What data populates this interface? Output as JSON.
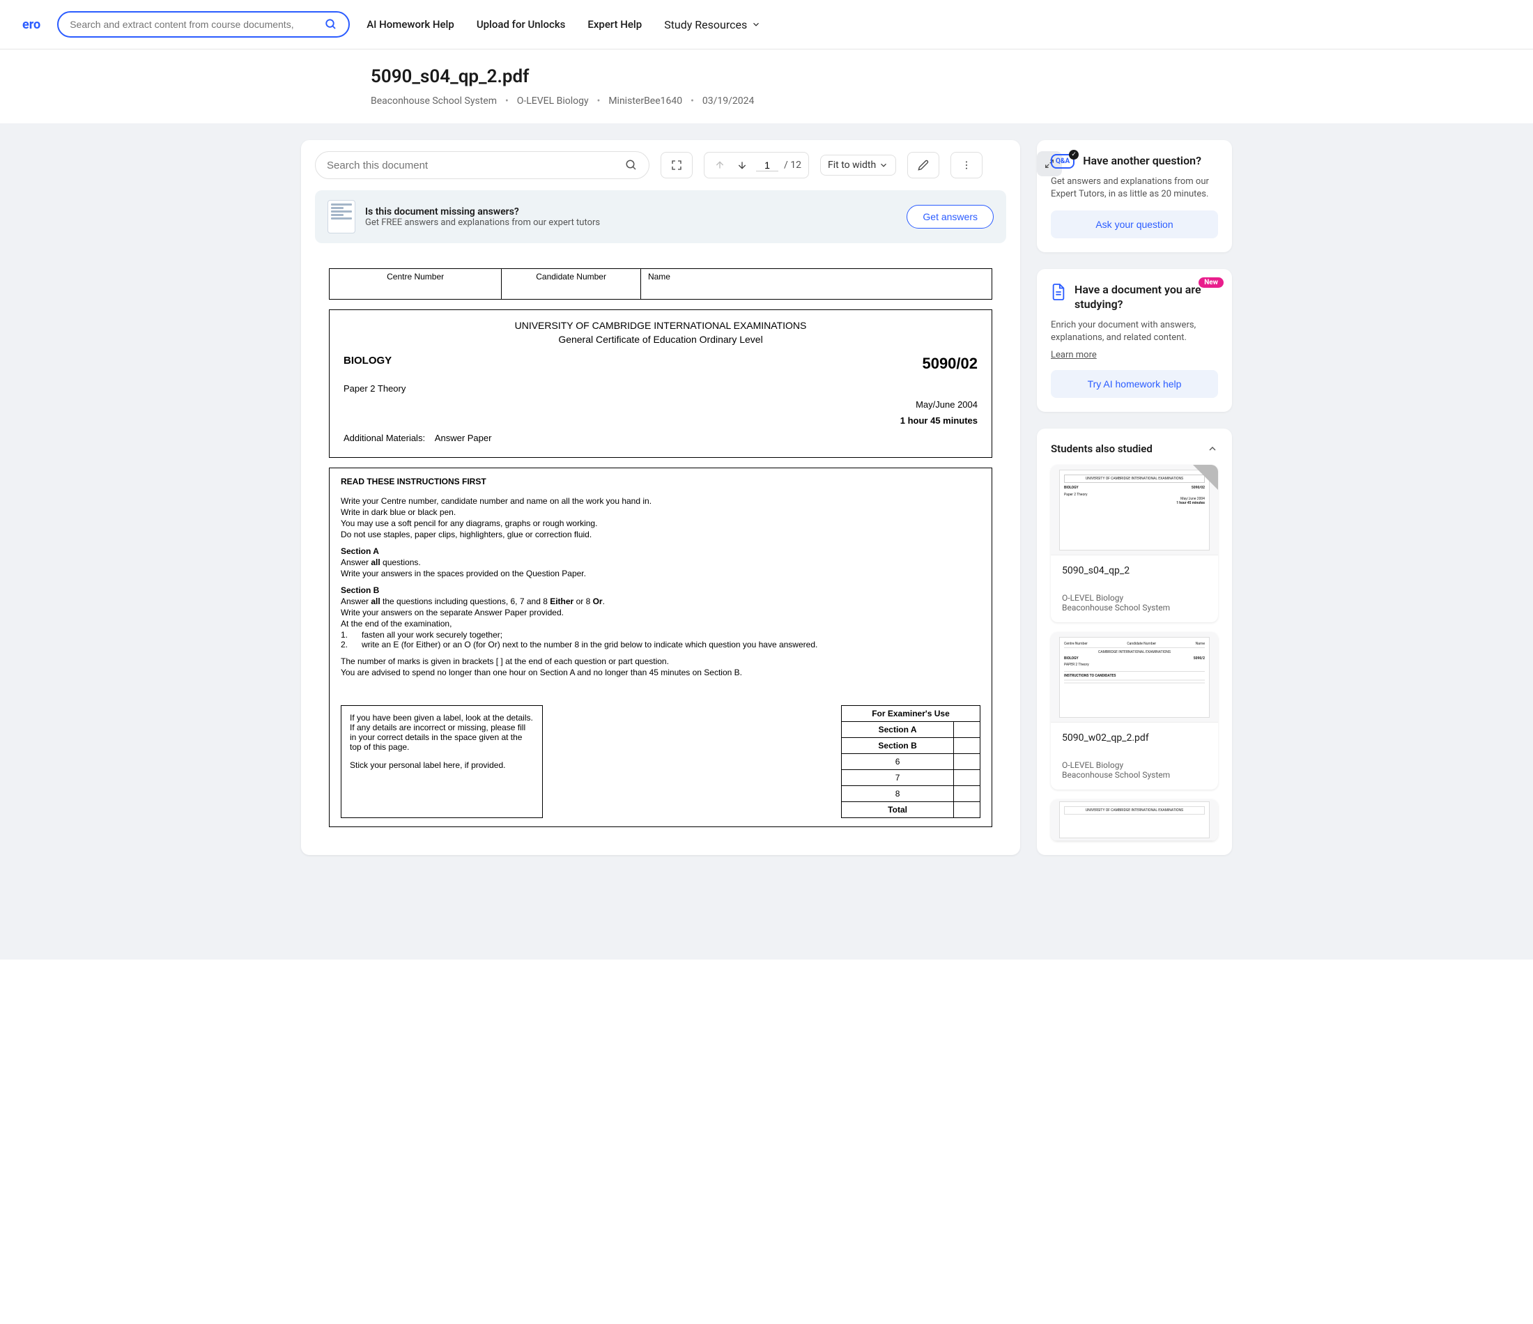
{
  "header": {
    "logo": "ero",
    "search_placeholder": "Search and extract content from course documents,",
    "nav": {
      "ai_hw": "AI Homework Help",
      "upload": "Upload for Unlocks",
      "expert": "Expert Help",
      "resources": "Study Resources"
    }
  },
  "title": {
    "filename": "5090_s04_qp_2.pdf",
    "school": "Beaconhouse School System",
    "course": "O-LEVEL Biology",
    "user": "MinisterBee1640",
    "date": "03/19/2024"
  },
  "docToolbar": {
    "search_placeholder": "Search this document",
    "page_current": "1",
    "page_total": "/ 12",
    "zoom": "Fit to width"
  },
  "banner": {
    "title": "Is this document missing answers?",
    "sub": "Get FREE answers and explanations from our expert tutors",
    "btn": "Get answers"
  },
  "exam": {
    "th_centre": "Centre Number",
    "th_candidate": "Candidate Number",
    "th_name": "Name",
    "uni_line": "UNIVERSITY OF CAMBRIDGE INTERNATIONAL EXAMINATIONS",
    "cert_line": "General Certificate of Education Ordinary Level",
    "subject": "BIOLOGY",
    "code": "5090/02",
    "paper": "Paper 2   Theory",
    "date": "May/June 2004",
    "duration": "1 hour 45 minutes",
    "materials_label": "Additional Materials:",
    "materials_value": "Answer Paper",
    "instr_head": "READ THESE INSTRUCTIONS FIRST",
    "instr_1": "Write your Centre number, candidate number and name on all the work you hand in.",
    "instr_2": "Write in dark blue or black pen.",
    "instr_3": "You may use a soft pencil for any diagrams, graphs or rough working.",
    "instr_4": "Do not use staples, paper clips, highlighters, glue or correction fluid.",
    "sectA": "Section A",
    "sectA_1a": "Answer ",
    "sectA_1b": "all",
    "sectA_1c": " questions.",
    "sectA_2": "Write your answers in the spaces provided on the Question Paper.",
    "sectB": "Section B",
    "sectB_1a": "Answer ",
    "sectB_1b": "all",
    "sectB_1c": " the questions including questions, 6, 7 and 8 ",
    "sectB_1d": "Either",
    "sectB_1e": " or 8 ",
    "sectB_1f": "Or",
    "sectB_1g": ".",
    "sectB_2": "Write your answers on the separate Answer Paper provided.",
    "sectB_3": "At the end of the examination,",
    "sectB_li1": "fasten all your work securely together;",
    "sectB_li2": "write an E (for Either) or an O (for Or) next to the number 8 in the grid below to indicate which question you have answered.",
    "marks_1": "The number of marks is given in brackets [  ] at the end of each question or part question.",
    "marks_2": "You are advised to spend no longer than one hour on Section A and no longer than 45 minutes on Section B.",
    "label_1": "If you have been given a label, look at the details. If any details are incorrect or missing, please fill in your correct details in the space given at the top of this page.",
    "label_2": "Stick your personal label here, if provided.",
    "ex_head": "For Examiner's Use",
    "ex_a": "Section A",
    "ex_b": "Section B",
    "ex_6": "6",
    "ex_7": "7",
    "ex_8": "8",
    "ex_total": "Total"
  },
  "qa": {
    "icon": "Q&A",
    "title": "Have another question?",
    "desc": "Get answers and explanations from our Expert Tutors, in as little as 20 minutes.",
    "btn": "Ask your question"
  },
  "study": {
    "badge": "New",
    "title": "Have a document you are studying?",
    "desc": "Enrich your document with answers, explanations, and related content.",
    "link": "Learn more",
    "btn": "Try AI homework help"
  },
  "also": {
    "heading": "Students also studied",
    "items": [
      {
        "title": "5090_s04_qp_2",
        "course": "O-LEVEL Biology",
        "school": "Beaconhouse School System"
      },
      {
        "title": "5090_w02_qp_2.pdf",
        "course": "O-LEVEL Biology",
        "school": "Beaconhouse School System"
      }
    ]
  }
}
